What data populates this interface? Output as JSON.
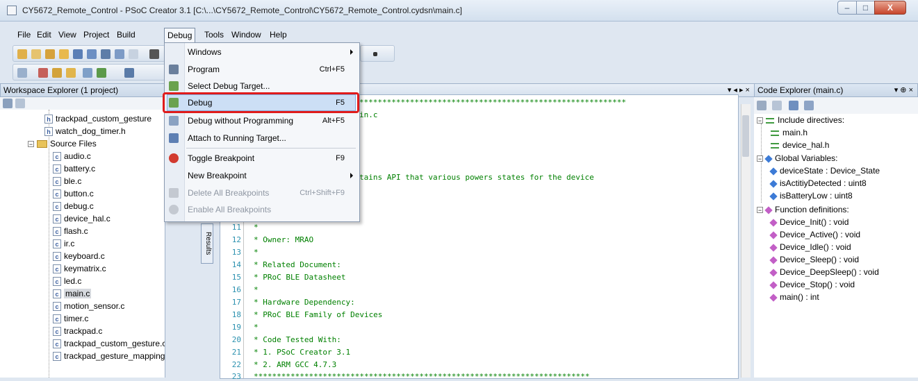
{
  "window": {
    "title": "CY5672_Remote_Control - PSoC Creator 3.1  [C:\\...\\CY5672_Remote_Control\\CY5672_Remote_Control.cydsn\\main.c]",
    "minimize_glyph": "–",
    "maximize_glyph": "□",
    "close_glyph": "X"
  },
  "menubar": [
    "File",
    "Edit",
    "View",
    "Project",
    "Build",
    "Debug",
    "Tools",
    "Window",
    "Help"
  ],
  "debug_menu": {
    "items": [
      {
        "label": "Windows",
        "shortcut": "",
        "submenu": true,
        "enabled": true
      },
      {
        "label": "Program",
        "shortcut": "Ctrl+F5",
        "submenu": false,
        "enabled": true
      },
      {
        "label": "Select Debug Target...",
        "shortcut": "",
        "submenu": false,
        "enabled": true
      },
      {
        "label": "Debug",
        "shortcut": "F5",
        "submenu": false,
        "enabled": true,
        "highlighted": true
      },
      {
        "label": "Debug without Programming",
        "shortcut": "Alt+F5",
        "submenu": false,
        "enabled": true
      },
      {
        "label": "Attach to Running Target...",
        "shortcut": "",
        "submenu": false,
        "enabled": true
      },
      {
        "label": "Toggle Breakpoint",
        "shortcut": "F9",
        "submenu": false,
        "enabled": true
      },
      {
        "label": "New Breakpoint",
        "shortcut": "",
        "submenu": true,
        "enabled": true
      },
      {
        "label": "Delete All Breakpoints",
        "shortcut": "Ctrl+Shift+F9",
        "submenu": false,
        "enabled": false
      },
      {
        "label": "Enable All Breakpoints",
        "shortcut": "",
        "submenu": false,
        "enabled": false
      }
    ]
  },
  "workspace_explorer": {
    "title": "Workspace Explorer (1 project)",
    "items": [
      {
        "label": "trackpad_custom_gesture",
        "type": "h"
      },
      {
        "label": "watch_dog_timer.h",
        "type": "h"
      },
      {
        "label": "Source Files",
        "type": "folder"
      },
      {
        "label": "audio.c",
        "type": "c"
      },
      {
        "label": "battery.c",
        "type": "c"
      },
      {
        "label": "ble.c",
        "type": "c"
      },
      {
        "label": "button.c",
        "type": "c"
      },
      {
        "label": "debug.c",
        "type": "c"
      },
      {
        "label": "device_hal.c",
        "type": "c"
      },
      {
        "label": "flash.c",
        "type": "c"
      },
      {
        "label": "ir.c",
        "type": "c"
      },
      {
        "label": "keyboard.c",
        "type": "c"
      },
      {
        "label": "keymatrix.c",
        "type": "c"
      },
      {
        "label": "led.c",
        "type": "c"
      },
      {
        "label": "main.c",
        "type": "c",
        "selected": true
      },
      {
        "label": "motion_sensor.c",
        "type": "c"
      },
      {
        "label": "timer.c",
        "type": "c"
      },
      {
        "label": "trackpad.c",
        "type": "c"
      },
      {
        "label": "trackpad_custom_gesture.c",
        "type": "c"
      },
      {
        "label": "trackpad_gesture_mapping.c",
        "type": "c"
      }
    ]
  },
  "results_tab": "Results",
  "editor": {
    "tab_controls": "▾ ◂ ▸ ×",
    "visible_fragments": [
      {
        "text": "*************************************************************",
        "row": 0
      },
      {
        "text": "in.c",
        "row": 1
      },
      {
        "text": "tains API that various powers states for the device",
        "row": 6
      }
    ],
    "lines": [
      {
        "n": "11",
        "text": "*"
      },
      {
        "n": "12",
        "text": "* Owner: MRAO"
      },
      {
        "n": "13",
        "text": "*"
      },
      {
        "n": "14",
        "text": "* Related Document:"
      },
      {
        "n": "15",
        "text": "* PRoC BLE Datasheet"
      },
      {
        "n": "16",
        "text": "*"
      },
      {
        "n": "17",
        "text": "* Hardware Dependency:"
      },
      {
        "n": "18",
        "text": "* PRoC BLE Family of Devices"
      },
      {
        "n": "19",
        "text": "*"
      },
      {
        "n": "20",
        "text": "* Code Tested With:"
      },
      {
        "n": "21",
        "text": "* 1. PSoC Creator 3.1"
      },
      {
        "n": "22",
        "text": "* 2. ARM GCC 4.7.3"
      },
      {
        "n": "23",
        "text": "*************************************************************************"
      }
    ]
  },
  "code_explorer": {
    "title": "Code Explorer (main.c)",
    "pin_glyphs": "▾ ⊕ ×",
    "groups": [
      {
        "label": "Include directives:",
        "kind": "include",
        "children": [
          "main.h",
          "device_hal.h"
        ]
      },
      {
        "label": "Global Variables:",
        "kind": "var",
        "children": [
          "deviceState : Device_State",
          "isActitiyDetected : uint8",
          "isBatteryLow : uint8"
        ]
      },
      {
        "label": "Function definitions:",
        "kind": "fn",
        "children": [
          "Device_Init() : void",
          "Device_Active() : void",
          "Device_Idle() : void",
          "Device_Sleep() : void",
          "Device_DeepSleep() : void",
          "Device_Stop() : void",
          "main() : int"
        ]
      }
    ]
  }
}
